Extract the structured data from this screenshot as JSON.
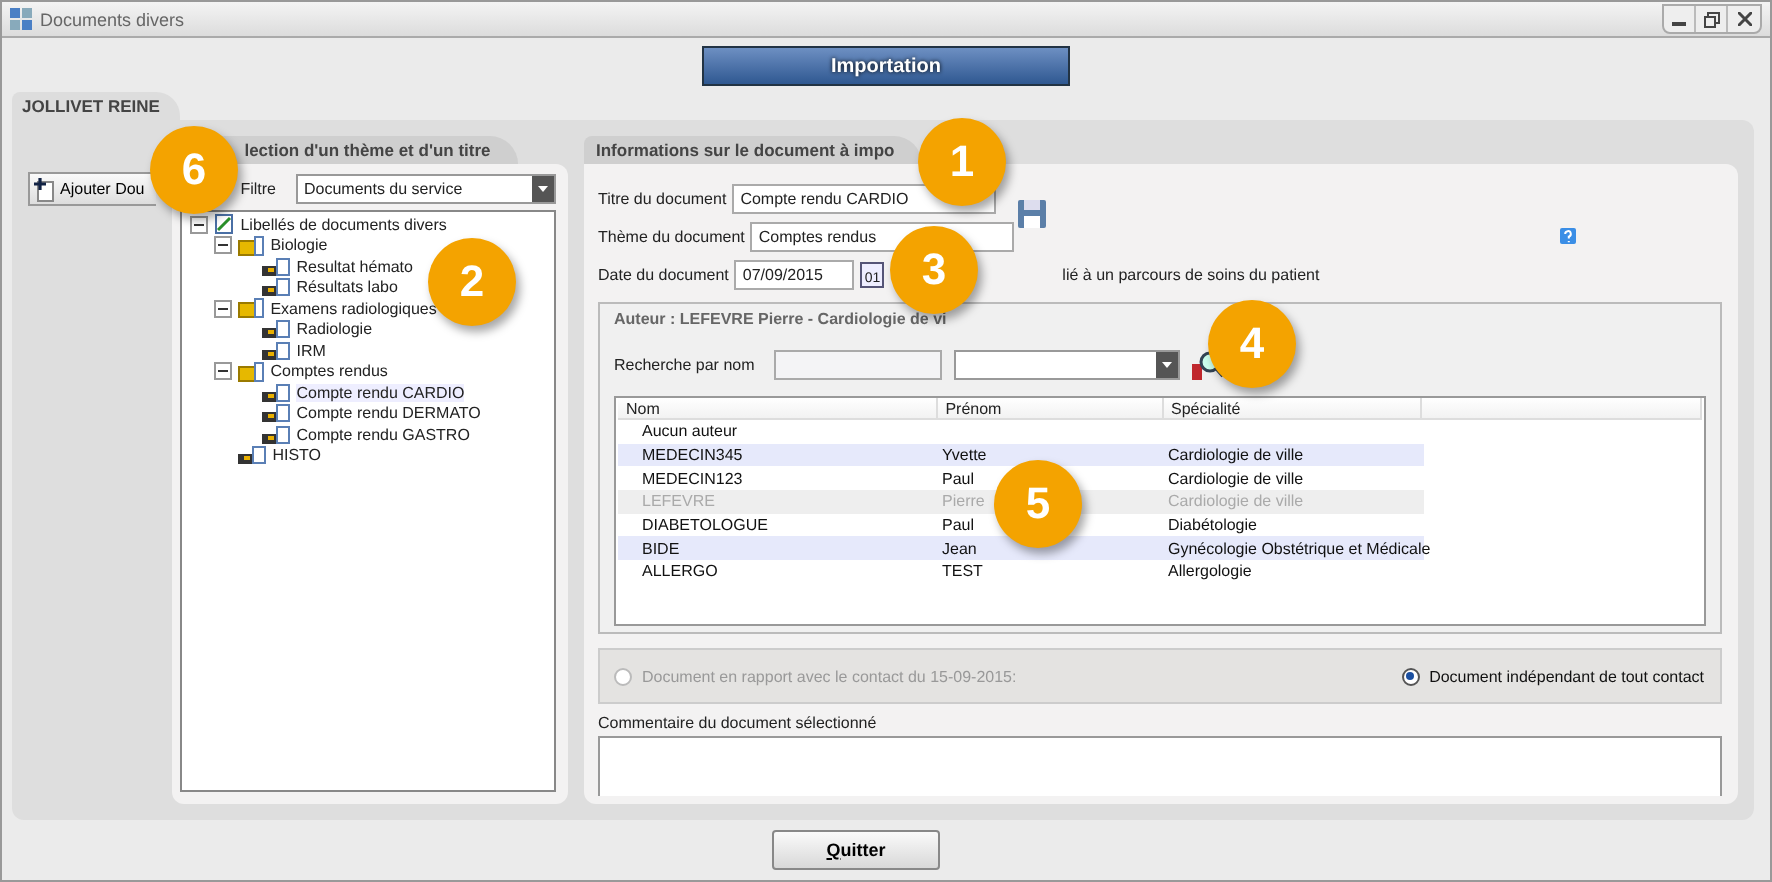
{
  "window": {
    "title": "Documents divers"
  },
  "header_button": "Importation",
  "patient_tab": "JOLLIVET REINE",
  "add_button": "Ajouter Dou",
  "theme_panel": {
    "title": "lection d'un thème et d'un titre",
    "filter_label": "Filtre",
    "filter_value": "Documents du service",
    "tree": [
      {
        "label": "Libellés de documents divers",
        "kind": "root",
        "expanded": true,
        "children": [
          {
            "label": "Biologie",
            "kind": "folder",
            "expanded": true,
            "children": [
              {
                "label": "Resultat hémato",
                "kind": "doc",
                "selected": false
              },
              {
                "label": "Résultats labo",
                "kind": "doc",
                "selected": false
              }
            ]
          },
          {
            "label": "Examens radiologiques",
            "kind": "folder",
            "expanded": true,
            "children": [
              {
                "label": "Radiologie",
                "kind": "doc",
                "selected": false
              },
              {
                "label": "IRM",
                "kind": "doc",
                "selected": false
              }
            ]
          },
          {
            "label": "Comptes rendus",
            "kind": "folder",
            "expanded": true,
            "children": [
              {
                "label": "Compte rendu CARDIO",
                "kind": "doc",
                "selected": true
              },
              {
                "label": "Compte rendu DERMATO",
                "kind": "doc",
                "selected": false
              },
              {
                "label": "Compte rendu GASTRO",
                "kind": "doc",
                "selected": false
              }
            ]
          },
          {
            "label": "HISTO",
            "kind": "doc",
            "selected": false
          }
        ]
      }
    ]
  },
  "info_panel": {
    "title": "Informations sur le document à impo",
    "fields": [
      {
        "label": "Titre du document",
        "value": "Compte rendu CARDIO"
      },
      {
        "label": "Thème du document",
        "value": "Comptes rendus"
      }
    ],
    "date_label": "Date du document",
    "date_value": "07/09/2015",
    "calendar_text": "01",
    "parcours_text": "lié à un parcours de soins du patient"
  },
  "author": {
    "title": "Auteur : LEFEVRE Pierre - Cardiologie de vi",
    "search_label": "Recherche par nom",
    "columns": [
      "Nom",
      "Prénom",
      "Spécialité"
    ],
    "rows": [
      {
        "cells": [
          "Aucun auteur",
          "",
          ""
        ],
        "selected": false
      },
      {
        "cells": [
          "MEDECIN345",
          "Yvette",
          "Cardiologie de ville"
        ],
        "selected": false
      },
      {
        "cells": [
          "MEDECIN123",
          "Paul",
          "Cardiologie de ville"
        ],
        "selected": false
      },
      {
        "cells": [
          "LEFEVRE",
          "Pierre",
          "Cardiologie de ville"
        ],
        "selected": true
      },
      {
        "cells": [
          "DIABETOLOGUE",
          "Paul",
          "Diabétologie"
        ],
        "selected": false
      },
      {
        "cells": [
          "BIDE",
          "Jean",
          "Gynécologie Obstétrique et Médicale"
        ],
        "selected": false
      },
      {
        "cells": [
          "ALLERGO",
          "TEST",
          "Allergologie"
        ],
        "selected": false
      }
    ]
  },
  "contact_options": [
    {
      "label": "Document en rapport avec le contact du 15-09-2015:",
      "selected": false,
      "disabled": true
    },
    {
      "label": "Document indépendant de tout contact",
      "selected": true,
      "disabled": false
    }
  ],
  "comment_label": "Commentaire du document sélectionné",
  "quit_button": "Quitter",
  "callouts": [
    "1",
    "2",
    "3",
    "4",
    "5",
    "6"
  ]
}
